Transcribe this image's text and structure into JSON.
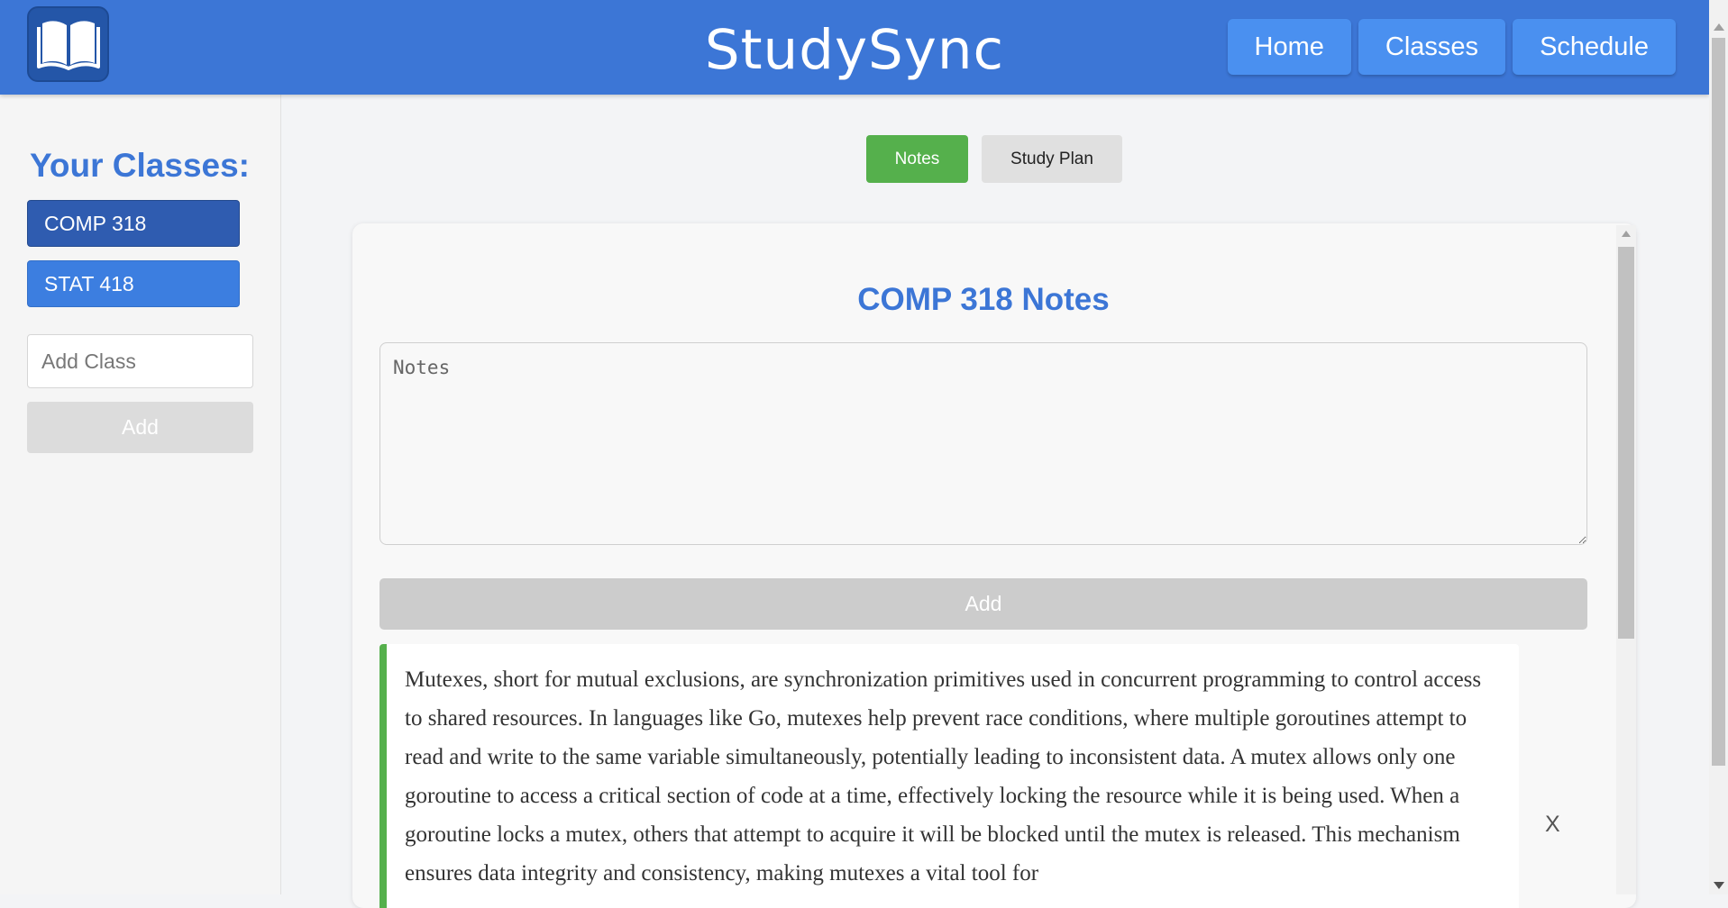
{
  "header": {
    "app_title": "StudySync",
    "logo_icon": "open-book-icon",
    "nav": [
      "Home",
      "Classes",
      "Schedule"
    ]
  },
  "sidebar": {
    "title": "Your Classes:",
    "classes": [
      {
        "label": "COMP 318",
        "active": true
      },
      {
        "label": "STAT 418",
        "active": false
      }
    ],
    "add_class_placeholder": "Add Class",
    "add_button_label": "Add"
  },
  "tabs": [
    {
      "label": "Notes",
      "active": true
    },
    {
      "label": "Study Plan",
      "active": false
    }
  ],
  "notes_panel": {
    "title": "COMP 318 Notes",
    "textarea_placeholder": "Notes",
    "add_button_label": "Add",
    "notes": [
      {
        "text": "Mutexes, short for mutual exclusions, are synchronization primitives used in concurrent programming to control access to shared resources. In languages like Go, mutexes help prevent race conditions, where multiple goroutines attempt to read and write to the same variable simultaneously, potentially leading to inconsistent data. A mutex allows only one goroutine to access a critical section of code at a time, effectively locking the resource while it is being used. When a goroutine locks a mutex, others that attempt to acquire it will be blocked until the mutex is released. This mechanism ensures data integrity and consistency, making mutexes a vital tool for",
        "delete_label": "X"
      }
    ]
  },
  "colors": {
    "primary": "#3c76d6",
    "active_tab": "#55b04c",
    "active_class": "#2f5cb0"
  }
}
